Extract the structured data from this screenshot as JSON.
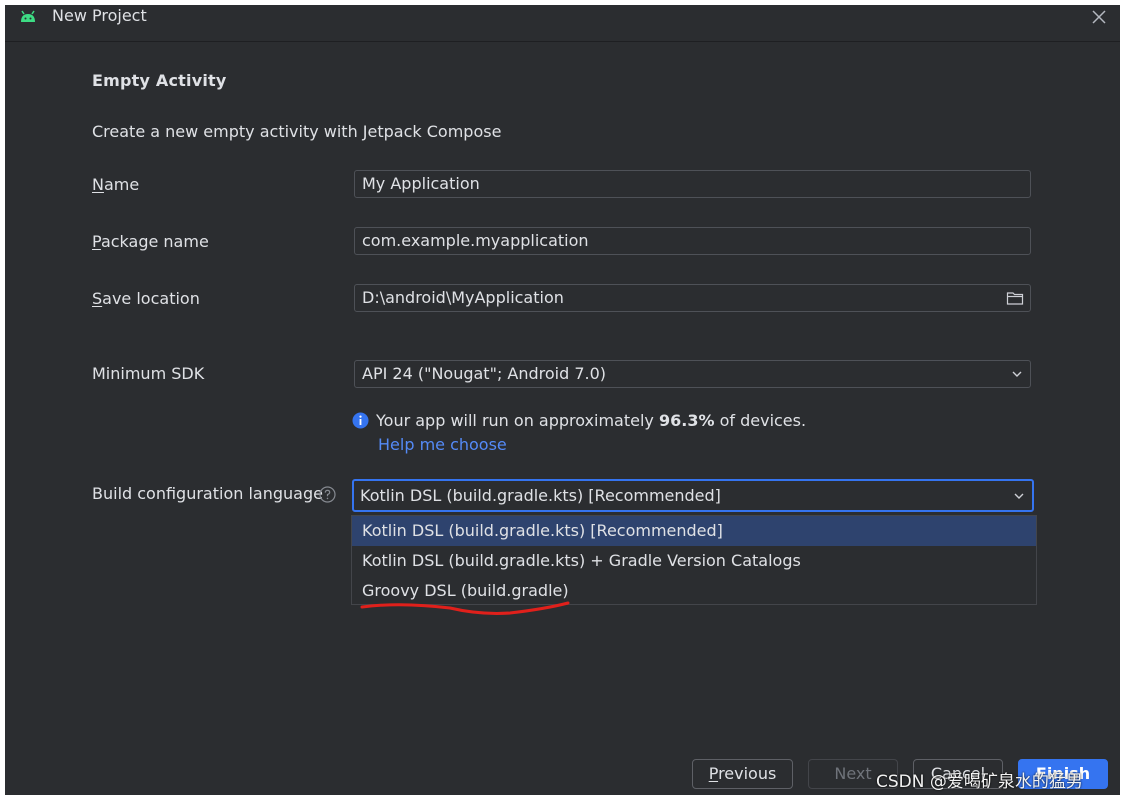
{
  "window": {
    "title": "New Project",
    "close_icon": "close-icon",
    "app_icon": "android-icon"
  },
  "template": {
    "title": "Empty Activity",
    "description": "Create a new empty activity with Jetpack Compose"
  },
  "form": {
    "name": {
      "mnemonic": "N",
      "label_rest": "ame",
      "value": "My Application"
    },
    "package": {
      "mnemonic": "P",
      "label_rest": "ackage name",
      "value": "com.example.myapplication"
    },
    "save_location": {
      "mnemonic": "S",
      "label_rest": "ave location",
      "value": "D:\\android\\MyApplication",
      "icon": "folder-icon"
    },
    "min_sdk": {
      "label": "Minimum SDK",
      "value": "API 24 (\"Nougat\"; Android 7.0)"
    },
    "info": {
      "prefix": "Your app will run on approximately ",
      "percent": "96.3%",
      "suffix": " of devices.",
      "link": "Help me choose"
    },
    "build_lang": {
      "label": "Build configuration language",
      "value": "Kotlin DSL (build.gradle.kts) [Recommended]",
      "options": [
        "Kotlin DSL (build.gradle.kts) [Recommended]",
        "Kotlin DSL (build.gradle.kts) + Gradle Version Catalogs",
        "Groovy DSL (build.gradle)"
      ],
      "selected_index": 0
    }
  },
  "buttons": {
    "previous_mnemonic": "P",
    "previous_rest": "revious",
    "next": "Next",
    "cancel": "Cancel",
    "finish": "Finish"
  },
  "watermark": "CSDN @爱喝矿泉水的猛男",
  "colors": {
    "background": "#2b2d30",
    "text": "#dfe1e5",
    "accent": "#3574f0",
    "link": "#548af7",
    "selected_row": "#2e436e",
    "annotation": "#e0201b"
  }
}
